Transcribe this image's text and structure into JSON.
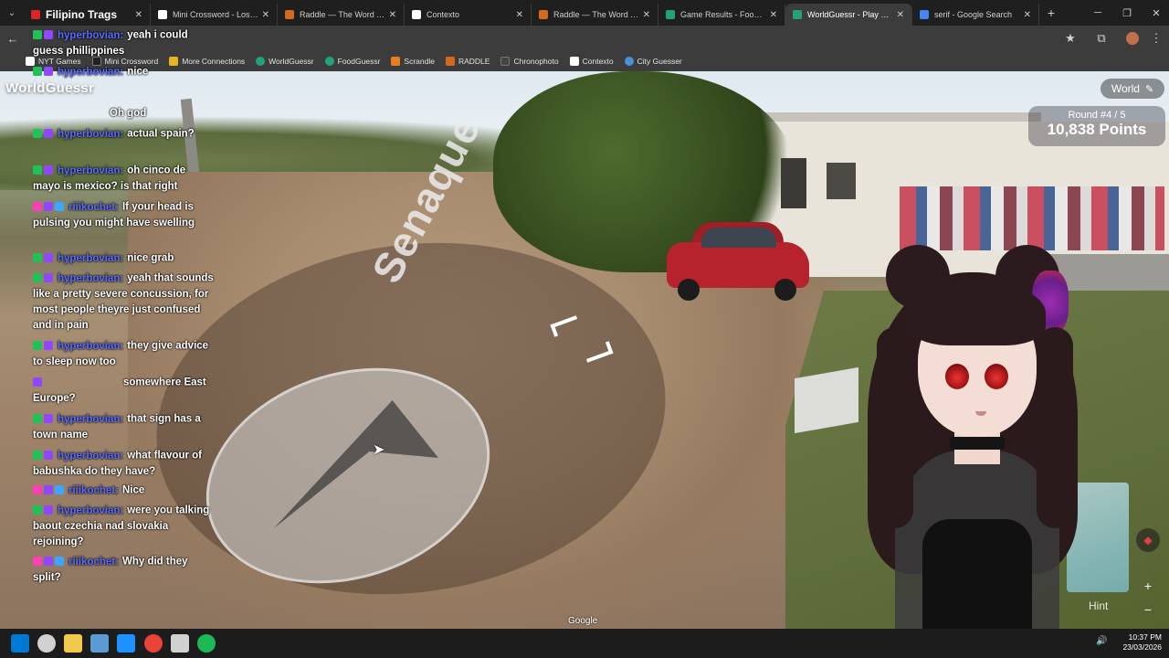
{
  "browser": {
    "tabs": [
      {
        "title": "Filipino Trags",
        "color": "#e02424"
      },
      {
        "title": "Mini Crossword - Los Ang",
        "color": "#ffffff"
      },
      {
        "title": "Raddle — The Word Tran",
        "color": "#d2691e"
      },
      {
        "title": "Contexto",
        "color": "#ffffff"
      },
      {
        "title": "Raddle — The Word Tran",
        "color": "#d2691e"
      },
      {
        "title": "Game Results - FoodGues",
        "color": "#21a37a"
      },
      {
        "title": "WorldGuessr - Play Geog",
        "color": "#21a37a"
      },
      {
        "title": "serif - Google Search",
        "color": "#4285f4"
      }
    ],
    "active_tab": 6,
    "new_tab": "+",
    "window_controls": {
      "minimize": "─",
      "restore": "❐",
      "close": "✕"
    },
    "back_icon": "←",
    "star_icon": "★",
    "extensions_icon": "⧉",
    "menu_icon": "⋮",
    "bookmarks": [
      {
        "label": "NYT Games",
        "color": "#ffffff"
      },
      {
        "label": "Mini Crossword",
        "color": "#222222"
      },
      {
        "label": "More Connections",
        "color": "#e6b422"
      },
      {
        "label": "WorldGuessr",
        "color": "#21a37a"
      },
      {
        "label": "FoodGuessr",
        "color": "#21a37a"
      },
      {
        "label": "Scrandle",
        "color": "#e67e22"
      },
      {
        "label": "RADDLE",
        "color": "#d2691e"
      },
      {
        "label": "Chronophoto",
        "color": "#444444"
      },
      {
        "label": "Contexto",
        "color": "#ffffff"
      },
      {
        "label": "City Guesser",
        "color": "#4a90d9"
      }
    ]
  },
  "game": {
    "logo": "WorldGuessr",
    "mode": "World",
    "round": "Round #4 / 5",
    "points": "10,838 Points",
    "hint": "Hint",
    "street_label": "Senaque",
    "map_zoom_in": "+",
    "map_zoom_out": "−",
    "watermark": "Google"
  },
  "chat": [
    {
      "user": "hyperbovian:",
      "text": "yeah i could guess phillippines",
      "badges": [
        "#21c15a",
        "#9146ff"
      ]
    },
    {
      "user": "hyperbovian:",
      "text": "nice",
      "badges": [
        "#21c15a",
        "#9146ff"
      ]
    },
    {
      "user": "",
      "text": "Oh god",
      "badges": []
    },
    {
      "user": "hyperbovian:",
      "text": "actual spain?",
      "badges": [
        "#21c15a",
        "#9146ff"
      ]
    },
    {
      "user": "hyperbovian:",
      "text": "oh cinco de mayo is mexico? is that right",
      "badges": [
        "#21c15a",
        "#9146ff"
      ]
    },
    {
      "user": "riiikochet:",
      "text": "If your head is pulsing you might have swelling",
      "badges": [
        "#ff3fb5",
        "#9146ff",
        "#3ea6ff"
      ]
    },
    {
      "user": "hyperbovian:",
      "text": "nice grab",
      "badges": [
        "#21c15a",
        "#9146ff"
      ]
    },
    {
      "user": "hyperbovian:",
      "text": "yeah that sounds like a pretty severe concussion, for most people theyre just confused and in pain",
      "badges": [
        "#21c15a",
        "#9146ff"
      ]
    },
    {
      "user": "hyperbovian:",
      "text": "they give advice to sleep now too",
      "badges": [
        "#21c15a",
        "#9146ff"
      ]
    },
    {
      "user": "",
      "text": "somewhere East Europe?",
      "badges": [
        "#9146ff"
      ]
    },
    {
      "user": "hyperbovian:",
      "text": "that sign has a town name",
      "badges": [
        "#21c15a",
        "#9146ff"
      ]
    },
    {
      "user": "hyperbovian:",
      "text": "what flavour of babushka do they have?",
      "badges": [
        "#21c15a",
        "#9146ff"
      ]
    },
    {
      "user": "riiikochet:",
      "text": "Nice",
      "badges": [
        "#ff3fb5",
        "#9146ff",
        "#3ea6ff"
      ]
    },
    {
      "user": "hyperbovian:",
      "text": "were you talking baout czechia nad slovakia rejoining?",
      "badges": [
        "#21c15a",
        "#9146ff"
      ]
    },
    {
      "user": "riiikochet:",
      "text": "Why did they split?",
      "badges": [
        "#ff3fb5",
        "#9146ff",
        "#3ea6ff"
      ]
    }
  ],
  "taskbar": {
    "time": "10:37 PM",
    "date": "23/03/2026",
    "apps": [
      "#0078d4",
      "#ffffff",
      "#f2c94c",
      "#5a9bd5",
      "#1e90ff",
      "#ea4335",
      "#ffffff",
      "#1db954"
    ]
  }
}
